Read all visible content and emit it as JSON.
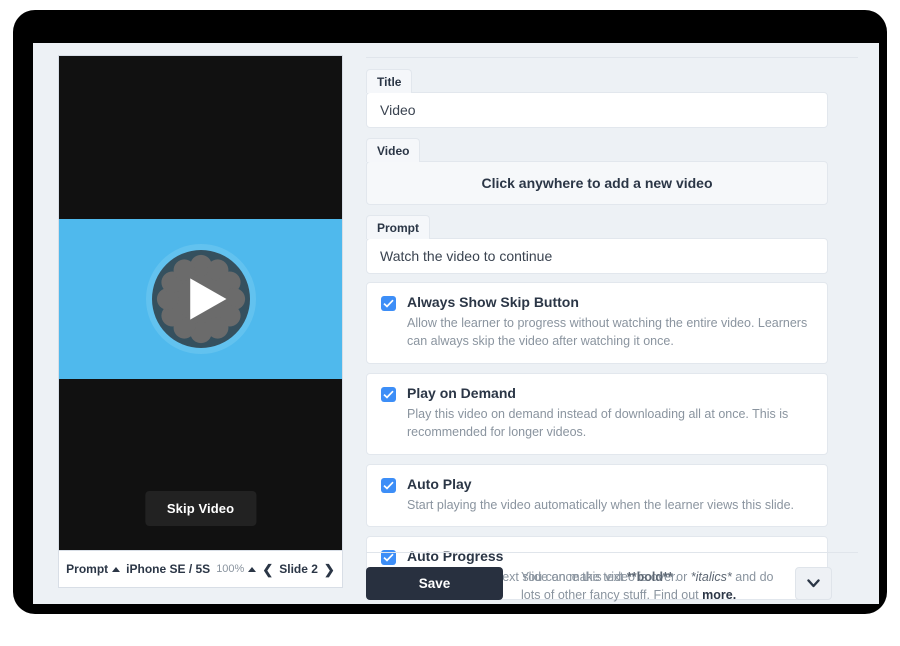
{
  "preview": {
    "skip_button_label": "Skip Video",
    "toolbar": {
      "prompt_label": "Prompt",
      "device_label": "iPhone SE / 5S",
      "zoom_label": "100%",
      "slide_label": "Slide 2",
      "prev_icon": "chevron-left-icon",
      "next_icon": "chevron-right-icon",
      "prompt_caret_icon": "caret-up-icon",
      "zoom_caret_icon": "caret-up-icon"
    },
    "play_icon": "play-icon",
    "colors": {
      "video_band": "#4FB9ED",
      "stage": "#111111",
      "play_disc": "#35505E",
      "gear": "#6B6B6B"
    }
  },
  "form": {
    "title_field": {
      "label": "Title",
      "value": "Video"
    },
    "video_field": {
      "label": "Video",
      "dropzone_label": "Click anywhere to add a new video"
    },
    "prompt_field": {
      "label": "Prompt",
      "value": "Watch the video to continue"
    },
    "options": [
      {
        "title": "Always Show Skip Button",
        "description": "Allow the learner to progress without watching the entire video. Learners can always skip the video after watching it once.",
        "checked": true
      },
      {
        "title": "Play on Demand",
        "description": "Play this video on demand instead of downloading all at once. This is recommended for longer videos.",
        "checked": true
      },
      {
        "title": "Auto Play",
        "description": "Start playing the video automatically when the learner views this slide.",
        "checked": true
      },
      {
        "title": "Auto Progress",
        "description": "Continue to the next slide once this video is over.",
        "checked": true
      }
    ]
  },
  "footer": {
    "save_label": "Save",
    "help_prefix": "You can make text ",
    "help_bold": "**bold**",
    "help_mid": " or ",
    "help_italic": "*italics*",
    "help_suffix": " and do lots of other fancy stuff. Find out ",
    "help_more": "more.",
    "expand_icon": "chevron-down-icon"
  },
  "colors": {
    "accent_blue": "#3D8EF7",
    "save_navy": "#28303F",
    "panel_bg": "#EDF1F5"
  }
}
